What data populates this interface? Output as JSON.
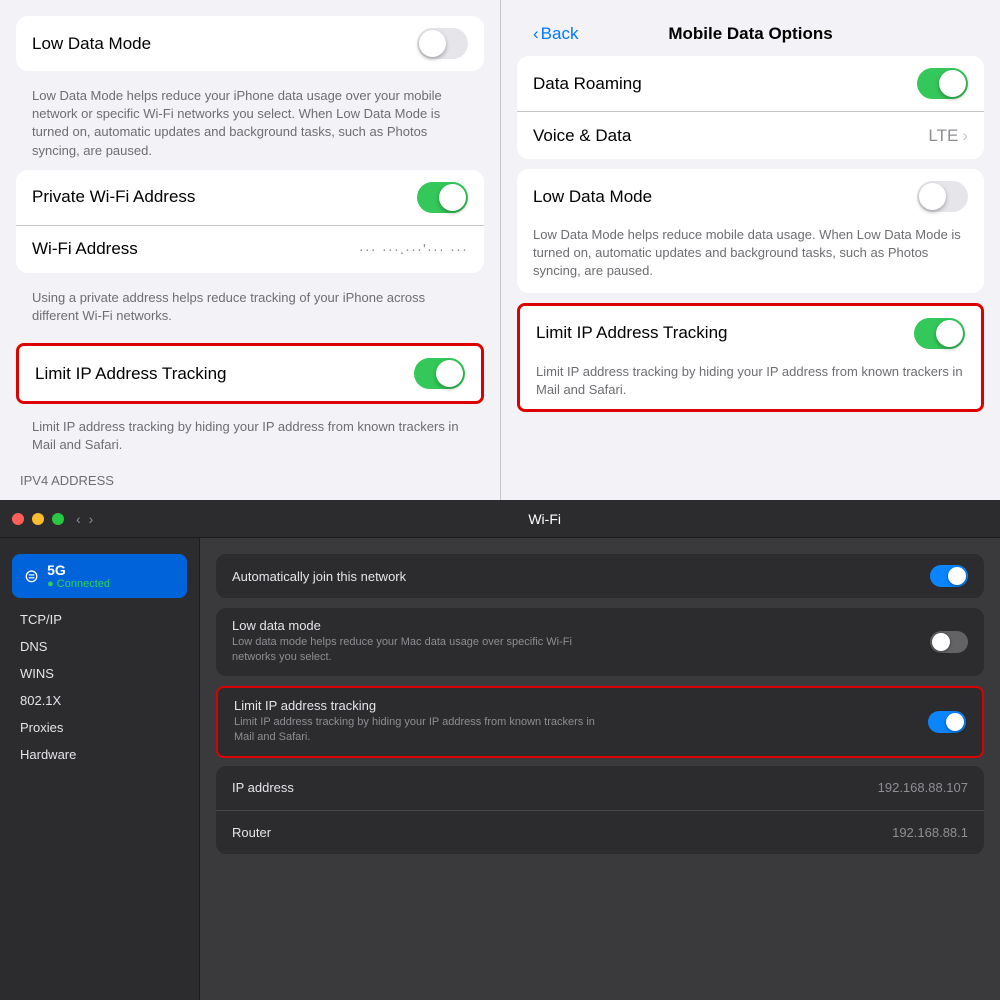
{
  "ios_left": {
    "section1": {
      "row1_label": "Low Data Mode",
      "toggle1_state": "off",
      "description": "Low Data Mode helps reduce your iPhone data usage over your mobile network or specific Wi-Fi networks you select. When Low Data Mode is turned on, automatic updates and background tasks, such as Photos syncing, are paused."
    },
    "section2": {
      "row1_label": "Private Wi-Fi Address",
      "toggle1_state": "on",
      "row2_label": "Wi-Fi Address",
      "row2_value": "••• •••.•••'••• •••",
      "description": "Using a private address helps reduce tracking of your iPhone across different Wi-Fi networks."
    },
    "section3": {
      "row1_label": "Limit IP Address Tracking",
      "toggle1_state": "on",
      "description": "Limit IP address tracking by hiding your IP address from known trackers in Mail and Safari."
    },
    "ipv4_label": "IPV4 ADDRESS"
  },
  "ios_right": {
    "nav_back": "Back",
    "nav_title": "Mobile Data Options",
    "section1": {
      "row1_label": "Data Roaming",
      "toggle1_state": "on",
      "row2_label": "Voice & Data",
      "row2_value": "LTE"
    },
    "section2": {
      "row1_label": "Low Data Mode",
      "toggle1_state": "off",
      "description": "Low Data Mode helps reduce mobile data usage. When Low Data Mode is turned on, automatic updates and background tasks, such as Photos syncing, are paused."
    },
    "section3": {
      "row1_label": "Limit IP Address Tracking",
      "toggle1_state": "on",
      "description": "Limit IP address tracking by hiding your IP address from known trackers in Mail and Safari."
    }
  },
  "mac": {
    "titlebar": {
      "title": "Wi-Fi"
    },
    "sidebar": {
      "network_name": "5G",
      "network_status": "● Connected",
      "items": [
        "TCP/IP",
        "DNS",
        "WINS",
        "802.1X",
        "Proxies",
        "Hardware"
      ]
    },
    "main": {
      "row1_label": "Automatically join this network",
      "toggle1_state": "on",
      "row2_label": "Low data mode",
      "row2_sublabel": "Low data mode helps reduce your Mac data usage over specific Wi-Fi networks you select.",
      "toggle2_state": "off",
      "row3_label": "Limit IP address tracking",
      "row3_sublabel": "Limit IP address tracking by hiding your IP address from known trackers in Mail and Safari.",
      "toggle3_state": "on",
      "row4_label": "IP address",
      "row4_value": "192.168.88.107",
      "row5_label": "Router",
      "row5_value": "192.168.88.1"
    }
  }
}
